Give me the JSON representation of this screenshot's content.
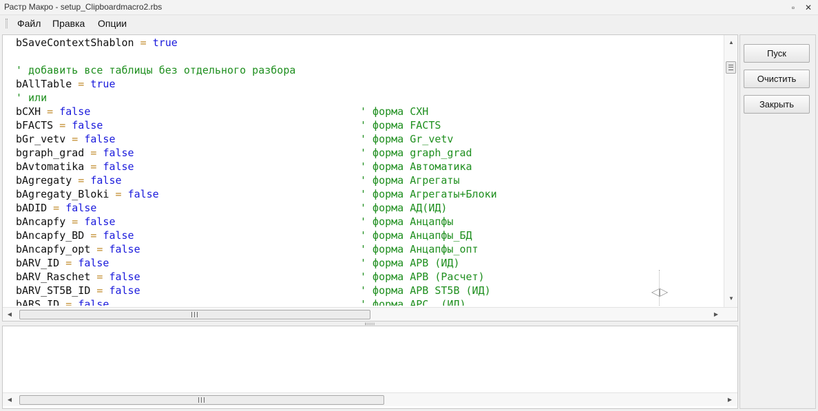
{
  "window": {
    "title": "Растр Макро - setup_Clipboardmacro2.rbs",
    "restore_glyph": "▫",
    "close_glyph": "✕"
  },
  "menu": {
    "items": [
      "Файл",
      "Правка",
      "Опции"
    ]
  },
  "editor": {
    "lines": [
      {
        "ident": "bSaveContextShablon",
        "op": " = ",
        "kw": "true",
        "comment": ""
      },
      {
        "ident": "",
        "op": "",
        "kw": "",
        "comment": ""
      },
      {
        "ident": "",
        "op": "",
        "kw": "",
        "comment": "' добавить все таблицы без отдельного разбора"
      },
      {
        "ident": "bAllTable",
        "op": " = ",
        "kw": "true",
        "comment": ""
      },
      {
        "ident": "",
        "op": "",
        "kw": "",
        "comment": "' или"
      },
      {
        "ident": "bCXH",
        "op": " = ",
        "kw": "false",
        "comment": "' форма CXH"
      },
      {
        "ident": "bFACTS",
        "op": " = ",
        "kw": "false",
        "comment": "' форма FACTS"
      },
      {
        "ident": "bGr_vetv",
        "op": " = ",
        "kw": "false",
        "comment": "' форма Gr_vetv"
      },
      {
        "ident": "bgraph_grad",
        "op": " = ",
        "kw": "false",
        "comment": "' форма graph_grad"
      },
      {
        "ident": "bAvtomatika",
        "op": " = ",
        "kw": "false",
        "comment": "' форма Автоматика"
      },
      {
        "ident": "bAgregaty",
        "op": " = ",
        "kw": "false",
        "comment": "' форма Агрегаты"
      },
      {
        "ident": "bAgregaty_Bloki",
        "op": " = ",
        "kw": "false",
        "comment": "' форма Агрегаты+Блоки"
      },
      {
        "ident": "bADID",
        "op": " = ",
        "kw": "false",
        "comment": "' форма АД(ИД)"
      },
      {
        "ident": "bAncapfy",
        "op": " = ",
        "kw": "false",
        "comment": "' форма Анцапфы"
      },
      {
        "ident": "bAncapfy_BD",
        "op": " = ",
        "kw": "false",
        "comment": "' форма Анцапфы_БД"
      },
      {
        "ident": "bAncapfy_opt",
        "op": " = ",
        "kw": "false",
        "comment": "' форма Анцапфы_опт"
      },
      {
        "ident": "bARV_ID",
        "op": " = ",
        "kw": "false",
        "comment": "' форма АРВ (ИД)"
      },
      {
        "ident": "bARV_Raschet",
        "op": " = ",
        "kw": "false",
        "comment": "' форма АРВ (Расчет)"
      },
      {
        "ident": "bARV_ST5B_ID",
        "op": " = ",
        "kw": "false",
        "comment": "' форма АРВ ST5B (ИД)"
      },
      {
        "ident": "bARS_ID",
        "op": " = ",
        "kw": "false",
        "comment": "' форма АРС  (ИД)"
      }
    ],
    "scroll_up_glyph": "▲",
    "scroll_down_glyph": "▼",
    "scroll_left_glyph": "◀",
    "scroll_right_glyph": "▶",
    "vertical_scroll_position": 0.05,
    "horizontal_scroll_position": 0.0,
    "divider_handle_glyph": "◁▷"
  },
  "output": {
    "text": ""
  },
  "buttons": {
    "run": "Пуск",
    "clear": "Очистить",
    "close": "Закрыть"
  }
}
